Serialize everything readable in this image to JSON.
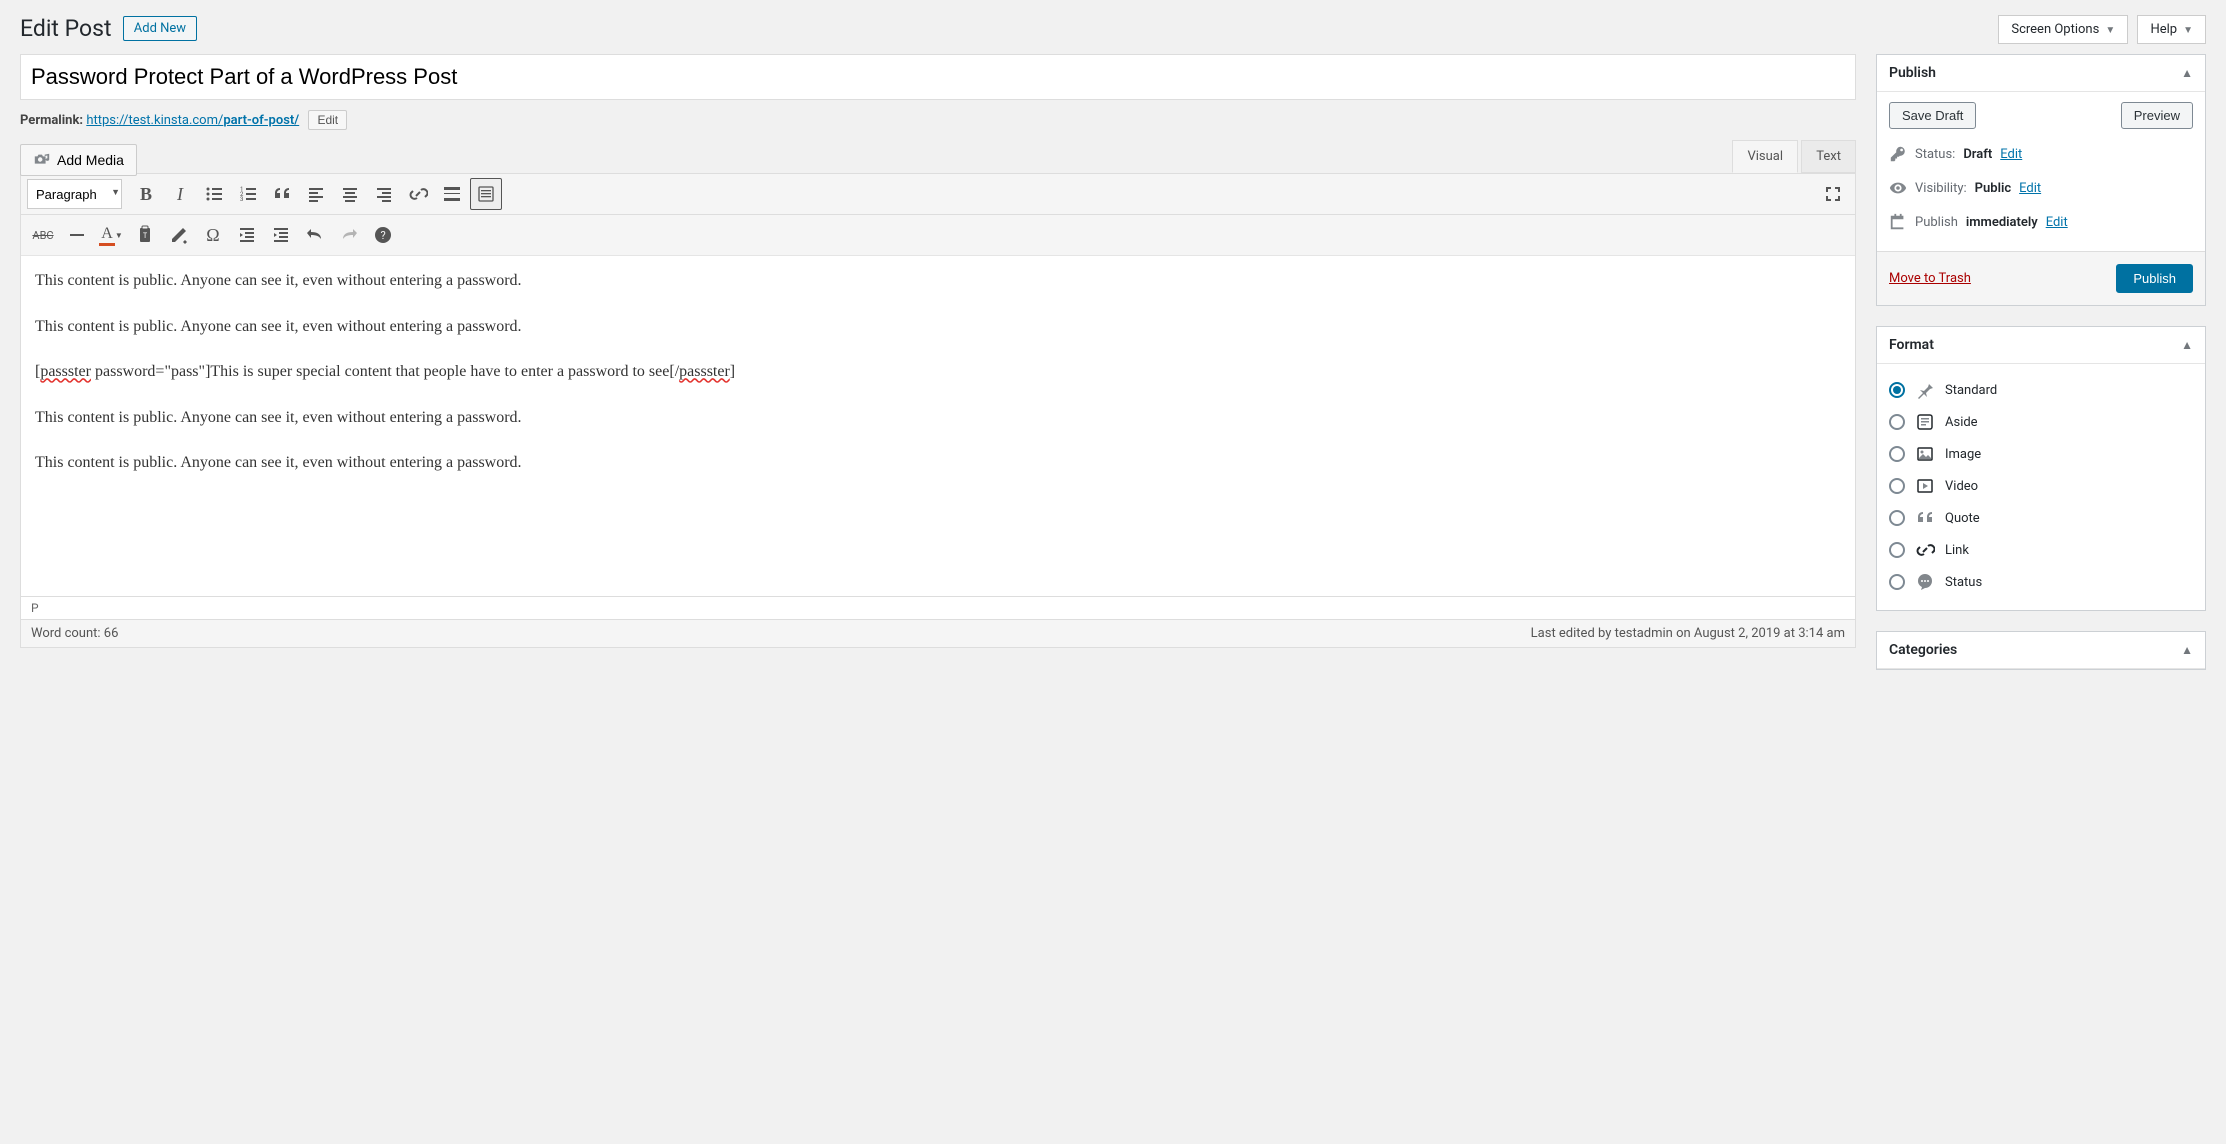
{
  "topButtons": {
    "screenOptions": "Screen Options",
    "help": "Help"
  },
  "header": {
    "title": "Edit Post",
    "addNew": "Add New"
  },
  "title": "Password Protect Part of a WordPress Post",
  "permalink": {
    "label": "Permalink:",
    "base": "https://test.kinsta.com/",
    "slug": "part-of-post/",
    "edit": "Edit"
  },
  "media": {
    "addMedia": "Add Media"
  },
  "tabs": {
    "visual": "Visual",
    "text": "Text"
  },
  "toolbar": {
    "format": "Paragraph"
  },
  "content": {
    "p1": "This content is public. Anyone can see it, even without entering a password.",
    "p2": "This content is public. Anyone can see it, even without entering a password.",
    "p3_open_tag": "passster",
    "p3_open_attr": " password=\"pass\"]",
    "p3_middle": "This is super special content that people have to enter a password to see",
    "p3_close_open": "[/",
    "p3_close_tag": "passster",
    "p3_close_end": "]",
    "p4": "This content is public. Anyone can see it, even without entering a password.",
    "p5": "This content is public. Anyone can see it, even without entering a password."
  },
  "pathBar": "P",
  "statusBar": {
    "wordCount": "Word count: 66",
    "lastEdit": "Last edited by testadmin on August 2, 2019 at 3:14 am"
  },
  "publish": {
    "title": "Publish",
    "saveDraft": "Save Draft",
    "preview": "Preview",
    "statusLabel": "Status:",
    "statusValue": "Draft",
    "visLabel": "Visibility:",
    "visValue": "Public",
    "schedLabel": "Publish",
    "schedValue": "immediately",
    "edit": "Edit",
    "trash": "Move to Trash",
    "publish": "Publish"
  },
  "format": {
    "title": "Format",
    "items": [
      "Standard",
      "Aside",
      "Image",
      "Video",
      "Quote",
      "Link",
      "Status"
    ]
  },
  "categories": {
    "title": "Categories"
  }
}
